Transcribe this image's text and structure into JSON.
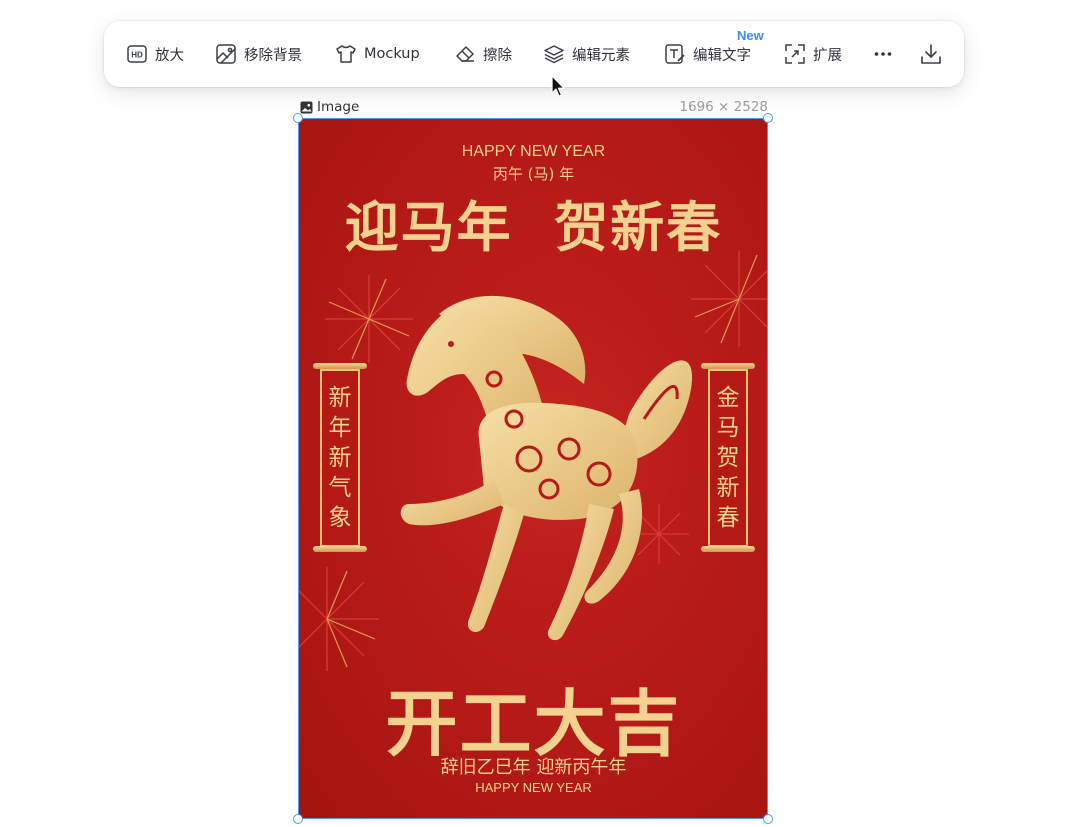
{
  "toolbar": {
    "items": [
      {
        "label": "放大",
        "icon": "hd-icon"
      },
      {
        "label": "移除背景",
        "icon": "remove-background-icon"
      },
      {
        "label": "Mockup",
        "icon": "tshirt-icon"
      },
      {
        "label": "擦除",
        "icon": "eraser-icon"
      },
      {
        "label": "编辑元素",
        "icon": "layers-icon"
      },
      {
        "label": "编辑文字",
        "icon": "edit-text-icon",
        "badge": "New"
      },
      {
        "label": "扩展",
        "icon": "expand-icon"
      }
    ],
    "more_icon": "more-icon",
    "download_icon": "download-icon"
  },
  "image_header": {
    "label": "Image",
    "dimensions": "1696 × 2528"
  },
  "poster": {
    "top_english": "HAPPY NEW YEAR",
    "top_year": "丙午 (马) 年",
    "headline": "迎马年  贺新春",
    "left_scroll": [
      "新",
      "年",
      "新",
      "气",
      "象"
    ],
    "right_scroll": [
      "金",
      "马",
      "贺",
      "新",
      "春"
    ],
    "main_title": "开工大吉",
    "subtitle": "辞旧乙巳年 迎新丙午年",
    "bottom_english": "HAPPY NEW YEAR"
  },
  "colors": {
    "accent_blue": "#4a9cf5",
    "badge_blue": "#3b8cf2",
    "poster_red": "#b51a17",
    "poster_gold": "#f3d28f"
  }
}
